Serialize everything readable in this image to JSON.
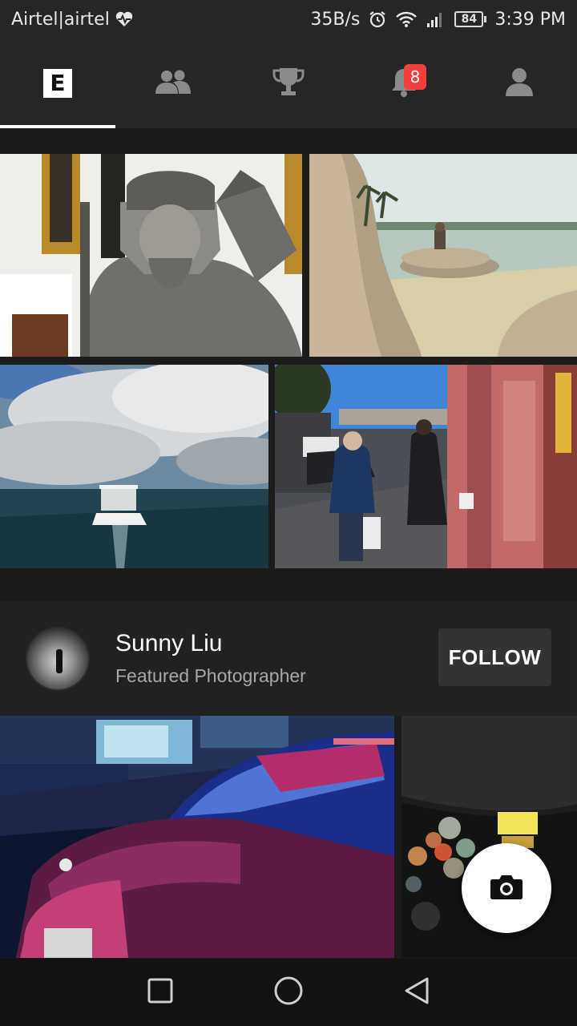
{
  "status_bar": {
    "carrier": "Airtel|airtel",
    "speed": "35B/s",
    "battery": "84",
    "time": "3:39 PM"
  },
  "tabs": [
    {
      "id": "editors",
      "label": "E"
    },
    {
      "id": "following",
      "icon": "people-icon"
    },
    {
      "id": "trophy",
      "icon": "trophy-icon"
    },
    {
      "id": "notifications",
      "icon": "bell-icon",
      "badge": "8"
    },
    {
      "id": "profile",
      "icon": "person-icon"
    }
  ],
  "featured": {
    "name": "Sunny Liu",
    "subtitle": "Featured Photographer",
    "follow_label": "FOLLOW"
  },
  "colors": {
    "background": "#1b1b1b",
    "bar": "#262626",
    "badge": "#f2413b",
    "button": "#333333"
  }
}
